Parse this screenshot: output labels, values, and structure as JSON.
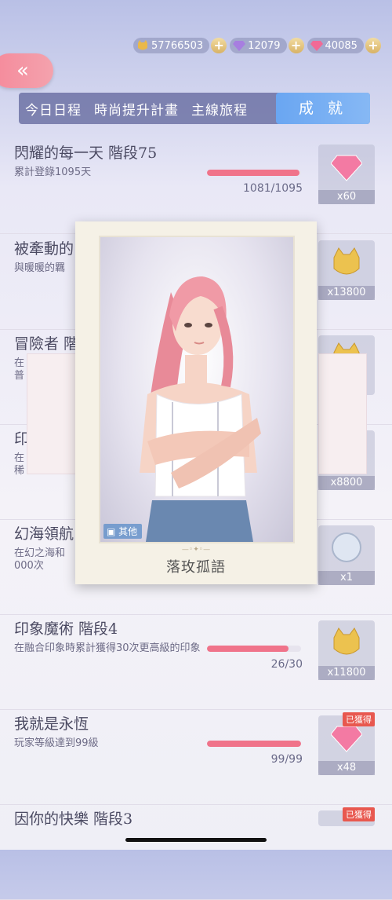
{
  "currency": {
    "gold": "57766503",
    "diamond_purple": "12079",
    "diamond_pink": "40085",
    "plus_label": "+"
  },
  "nav": {
    "back_label": "«"
  },
  "tabs": [
    {
      "label": "今日日程"
    },
    {
      "label": "時尚提升計畫"
    },
    {
      "label": "主線旅程"
    },
    {
      "label": "成 就"
    }
  ],
  "achievements": [
    {
      "title": "閃耀的每一天 階段75",
      "desc": "累計登錄1095天",
      "progress": "1081/1095",
      "fill": 0.987,
      "reward_count": "x60",
      "reward_icon": "diamond-icon"
    },
    {
      "title": "被牽動的",
      "desc": "與暖暖的羈",
      "progress": "",
      "fill": 0,
      "reward_count": "x13800",
      "reward_icon": "gold-coin-icon"
    },
    {
      "title": "冒險者 階",
      "desc": "在\n普",
      "progress": "",
      "fill": 0,
      "reward_count": "",
      "reward_icon": "gold-coin-icon"
    },
    {
      "title": "印",
      "desc": "在\n稀",
      "progress": "",
      "fill": 0,
      "reward_count": "x8800",
      "reward_icon": "gold-coin-icon"
    },
    {
      "title": "幻海領航",
      "desc": "在幻之海和\n000次",
      "progress": "",
      "fill": 0,
      "reward_count": "x1",
      "reward_icon": "silver-medal-icon"
    },
    {
      "title": "印象魔術 階段4",
      "desc": "在融合印象時累計獲得30次更高級的印象",
      "progress": "26/30",
      "fill": 0.867,
      "reward_count": "x11800",
      "reward_icon": "gold-coin-icon"
    },
    {
      "title": "我就是永恆",
      "desc": "玩家等級達到99級",
      "progress": "99/99",
      "fill": 1.0,
      "reward_count": "x48",
      "reward_icon": "diamond-icon",
      "badge": "已獲得"
    },
    {
      "title": "因你的快樂 階段3",
      "desc": "",
      "progress": "",
      "fill": 0,
      "reward_count": "",
      "reward_icon": "",
      "badge": "已獲得"
    }
  ],
  "popup": {
    "tag": "其他",
    "title": "落玫孤語"
  },
  "colors": {
    "accent_pink": "#f0738a",
    "tab_active": "#6aa6f2",
    "tab_bar": "#5f649b"
  }
}
